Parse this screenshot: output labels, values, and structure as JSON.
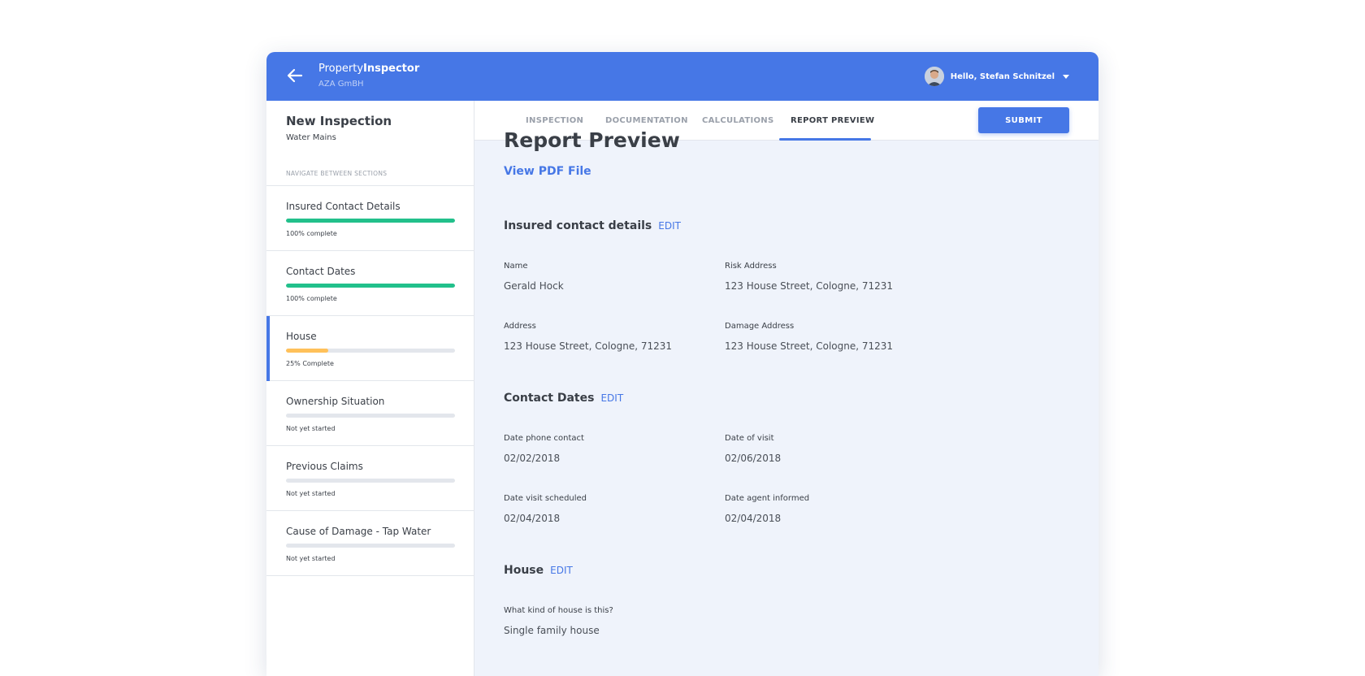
{
  "header": {
    "brand_light": "Property",
    "brand_bold": "Inspector",
    "company": "AZA GmBH",
    "user_greeting": "Hello, Stefan Schnitzel"
  },
  "sidebar": {
    "title": "New Inspection",
    "subtitle": "Water Mains",
    "nav_label": "NAVIGATE BETWEEN SECTIONS",
    "sections": [
      {
        "name": "Insured Contact Details",
        "progress": 1.0,
        "status": "100% complete",
        "color": "#22c08b"
      },
      {
        "name": "Contact Dates",
        "progress": 1.0,
        "status": "100% complete",
        "color": "#22c08b"
      },
      {
        "name": "House",
        "progress": 0.25,
        "status": "25% Complete",
        "color": "#ffc15a"
      },
      {
        "name": "Ownership Situation",
        "progress": 0,
        "status": "Not yet started",
        "color": "#22c08b"
      },
      {
        "name": "Previous Claims",
        "progress": 0,
        "status": "Not yet started",
        "color": "#22c08b"
      },
      {
        "name": "Cause of Damage - Tap Water",
        "progress": 0,
        "status": "Not yet started",
        "color": "#22c08b"
      }
    ]
  },
  "tabs": [
    "INSPECTION",
    "DOCUMENTATION",
    "CALCULATIONS",
    "REPORT PREVIEW"
  ],
  "active_tab": "REPORT PREVIEW",
  "submit_label": "SUBMIT",
  "report": {
    "title": "Report Preview",
    "pdf_link": "View PDF File",
    "edit_label": "EDIT",
    "insured": {
      "heading": "Insured contact details",
      "fields": [
        {
          "label": "Name",
          "value": "Gerald Hock"
        },
        {
          "label": "Risk Address",
          "value": "123 House Street, Cologne, 71231"
        },
        {
          "label": "Address",
          "value": "123 House Street, Cologne, 71231"
        },
        {
          "label": "Damage Address",
          "value": "123 House Street, Cologne, 71231"
        }
      ]
    },
    "contact_dates": {
      "heading": "Contact Dates",
      "fields": [
        {
          "label": "Date phone contact",
          "value": "02/02/2018"
        },
        {
          "label": "Date of visit",
          "value": "02/06/2018"
        },
        {
          "label": "Date visit scheduled",
          "value": "02/04/2018"
        },
        {
          "label": "Date agent informed",
          "value": "02/04/2018"
        }
      ]
    },
    "house": {
      "heading": "House",
      "fields": [
        {
          "label": "What kind of house is this?",
          "value": "Single family house"
        }
      ]
    }
  },
  "colors": {
    "accent": "#4677e6",
    "complete": "#22c08b",
    "partial": "#ffc15a"
  }
}
